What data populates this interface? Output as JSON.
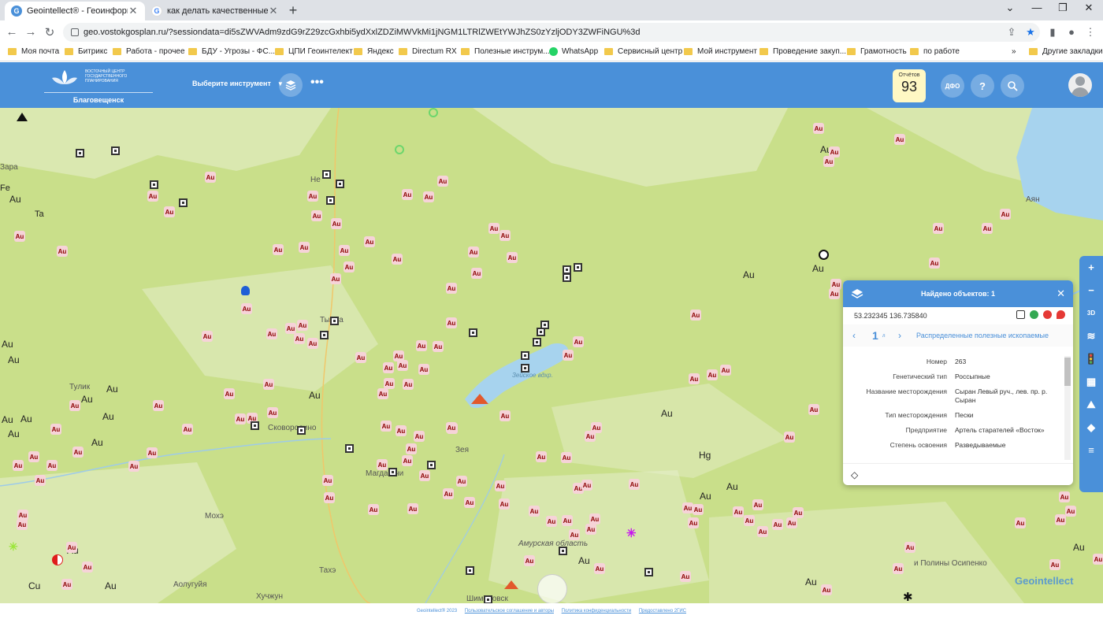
{
  "browser": {
    "tabs": [
      {
        "title": "Geointellect® - Геоинформацио",
        "active": true,
        "icon": "geointellect-favicon"
      },
      {
        "title": "как делать качественные сним",
        "active": false,
        "icon": "google-favicon"
      }
    ],
    "new_tab": "+",
    "url": "geo.vostokgosplan.ru/?sessiondata=di5sZWVAdm9zdG9rZ29zcGxhbi5ydXxlZDZiMWVkMi1jNGM1LTRlZWEtYWJhZS0zYzljODY3ZWFiNGU%3d",
    "bookmarks": [
      "Моя почта",
      "Битрикс",
      "Работа - прочее",
      "БДУ - Угрозы - ФС...",
      "ЦПИ Геоинтелект",
      "Яндекс",
      "Directum RX",
      "Полезные инструм...",
      "WhatsApp",
      "Сервисный центр",
      "Мой инструмент",
      "Проведение закуп...",
      "Грамотность",
      "по работе"
    ],
    "more_bookmarks": "»",
    "other_bookmarks": "Другие закладки"
  },
  "app": {
    "logo_text": "ВОСТОЧНЫЙ ЦЕНТР ГОСУДАРСТВЕННОГО ПЛАНИРОВАНИЯ",
    "city": "Благовещенск",
    "tool_select": "Выберите инструмент",
    "more": "•••",
    "reports_label": "Отчётов",
    "reports_count": "93",
    "dfo_label": "ДФО",
    "help_label": "?"
  },
  "map": {
    "place_labels": [
      "Зара",
      "Fe",
      "Ta",
      "Тулик",
      "Тында",
      "Сковородино",
      "Магдагачи",
      "Зея",
      "Зейское вдхр.",
      "Амурская область",
      "Мохэ",
      "Тахэ",
      "Аолугуйя",
      "Хучжун",
      "Шимановск",
      "Аян",
      "Hg",
      "и Полины Осипенко",
      "Cu",
      "Не"
    ],
    "au_label": "Au"
  },
  "popup": {
    "title": "Найдено объектов: 1",
    "coords": "53.232345 136.735840",
    "page": "1",
    "page_sub": "л",
    "layer": "Распределенные полезные ископаемые",
    "rows": [
      {
        "k": "Номер",
        "v": "263"
      },
      {
        "k": "Генетический тип",
        "v": "Россыпные"
      },
      {
        "k": "Название месторождения",
        "v": "Сыран Левый руч., лев. пр. р. Сыран"
      },
      {
        "k": "Тип месторождения",
        "v": "Пески"
      },
      {
        "k": "Предприятие",
        "v": "Артель старателей «Восток»"
      },
      {
        "k": "Степень освоения",
        "v": "Разведываемые"
      }
    ]
  },
  "right_toolbar": [
    "+",
    "−",
    "3D",
    "≋",
    "🚦",
    "▦",
    "⛰",
    "◆",
    "≡"
  ],
  "footer": {
    "copyright": "Geointellect® 2023",
    "terms": "Пользовательское соглашение и авторы",
    "privacy": "Политика конфиденциальности",
    "provided": "Предоставлено 2ГИС"
  },
  "watermark": "Geointellect",
  "colors": {
    "header": "#4a90d9",
    "map_green": "#c9df8a",
    "reports_bg": "#fff8c4",
    "water": "#a7d3ee"
  }
}
